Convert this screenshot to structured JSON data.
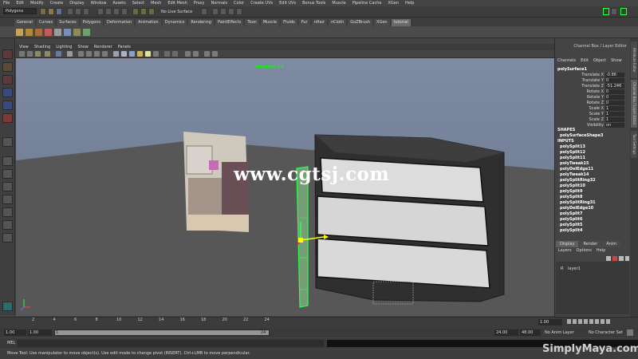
{
  "menu": [
    "File",
    "Edit",
    "Modify",
    "Create",
    "Display",
    "Window",
    "Assets",
    "Select",
    "Mesh",
    "Edit Mesh",
    "Proxy",
    "Normals",
    "Color",
    "Create UVs",
    "Edit UVs",
    "Bonus Tools",
    "Muscle",
    "Pipeline Cache",
    "XGen",
    "Help"
  ],
  "status": {
    "mode": "Polygons",
    "live_surface": "No Live Surface"
  },
  "shelf": {
    "tabs": [
      "General",
      "Curves",
      "Surfaces",
      "Polygons",
      "Deformation",
      "Animation",
      "Dynamics",
      "Rendering",
      "PaintEffects",
      "Toon",
      "Muscle",
      "Fluids",
      "Fur",
      "nHair",
      "nCloth",
      "GoZBrush",
      "XGen",
      "tutorial"
    ],
    "active": "tutorial"
  },
  "viewport": {
    "menu": [
      "View",
      "Shading",
      "Lighting",
      "Show",
      "Renderer",
      "Panels"
    ],
    "label": "Viewport 2.0",
    "watermark": "www.cgtsj.com"
  },
  "channel_box": {
    "title": "Channel Box / Layer Editor",
    "menu": [
      "Channels",
      "Edit",
      "Object",
      "Show"
    ],
    "object": "polySurface1",
    "attributes": [
      {
        "name": "Translate X",
        "value": "-0.86"
      },
      {
        "name": "Translate Y",
        "value": "0"
      },
      {
        "name": "Translate Z",
        "value": "-51.246"
      },
      {
        "name": "Rotate X",
        "value": "0"
      },
      {
        "name": "Rotate Y",
        "value": "0"
      },
      {
        "name": "Rotate Z",
        "value": "0"
      },
      {
        "name": "Scale X",
        "value": "1"
      },
      {
        "name": "Scale Y",
        "value": "1"
      },
      {
        "name": "Scale Z",
        "value": "1"
      },
      {
        "name": "Visibility",
        "value": "on"
      }
    ],
    "shapes_header": "SHAPES",
    "shape": "polySurfaceShape3",
    "inputs_header": "INPUTS",
    "inputs": [
      "polySplit13",
      "polySplit12",
      "polySplit11",
      "polyTweak15",
      "polyDelEdge11",
      "polyTweak14",
      "polySplitRing32",
      "polySplit10",
      "polySplit9",
      "polySplit8",
      "polySplitRing31",
      "polyDelEdge10",
      "polySplit7",
      "polySplit6",
      "polySplit5",
      "polySplit4"
    ]
  },
  "side_tabs": [
    "Attribute Editor",
    "Channel Box / Layer Editor",
    "Tool Settings"
  ],
  "layer_editor": {
    "tabs": [
      "Display",
      "Render",
      "Anim"
    ],
    "active": "Display",
    "menu": [
      "Layers",
      "Options",
      "Help"
    ],
    "layer_flag": "R",
    "layer_name": "layer1"
  },
  "timeline": {
    "ticks": [
      "2",
      "4",
      "6",
      "8",
      "10",
      "12",
      "14",
      "16",
      "18",
      "20",
      "22",
      "24"
    ],
    "current": "1.00"
  },
  "range": {
    "start": "1.00",
    "start_inner": "1.00",
    "slider_start": "1",
    "slider_end": "24",
    "end_inner": "24.00",
    "end": "48.00",
    "anim_layer": "No Anim Layer",
    "char_set": "No Character Set"
  },
  "mel_label": "MEL",
  "help_text": "Move Tool: Use manipulator to move object(s). Use edit mode to change pivot (INSERT). Ctrl+LMB to move perpendicular.",
  "logo": "SimplyMaya.com",
  "colors": {
    "accent_green": "#2dff4d",
    "manip_yellow": "#ffff00",
    "manip_red": "#ff2020"
  }
}
